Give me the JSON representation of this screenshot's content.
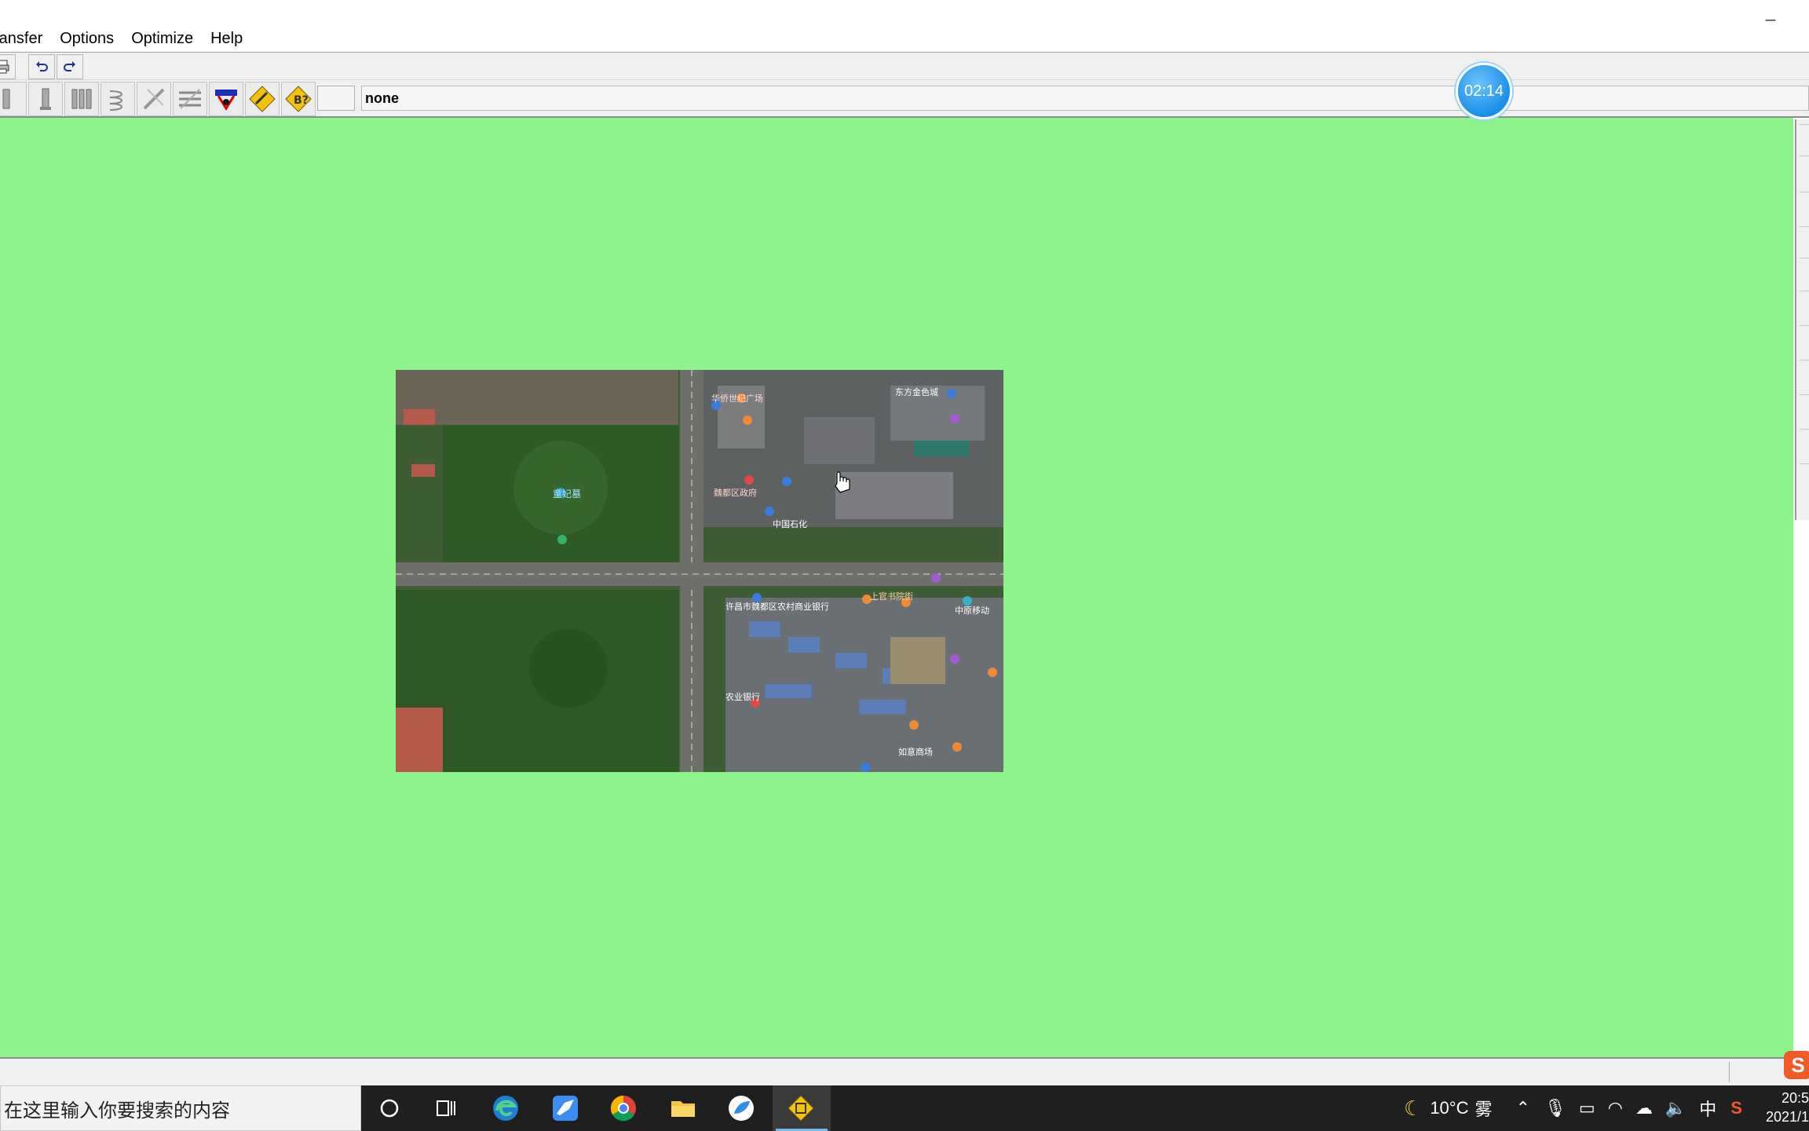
{
  "menu": {
    "items": [
      "ransfer",
      "Options",
      "Optimize",
      "Help"
    ]
  },
  "toolbar": {
    "status_value": "none"
  },
  "timer": {
    "time": "02:14"
  },
  "map": {
    "labels": [
      "华侨世纪广场",
      "农业银行",
      "童妃墓",
      "许昌市魏都区农村商业银行",
      "中原移动",
      "上官书院街",
      "中国石化",
      "东方金色城",
      "魏都区政府",
      "如意商场"
    ]
  },
  "taskbar": {
    "search_placeholder": "在这里输入你要搜索的内容",
    "weather_temp": "10°C",
    "weather_desc": "雾",
    "ime": "中",
    "clock_time": "20:5",
    "clock_date": "2021/1"
  },
  "colors": {
    "canvas": "#8cf48a",
    "taskbar": "#1f1f1f",
    "timer": "#1a8ee8"
  }
}
